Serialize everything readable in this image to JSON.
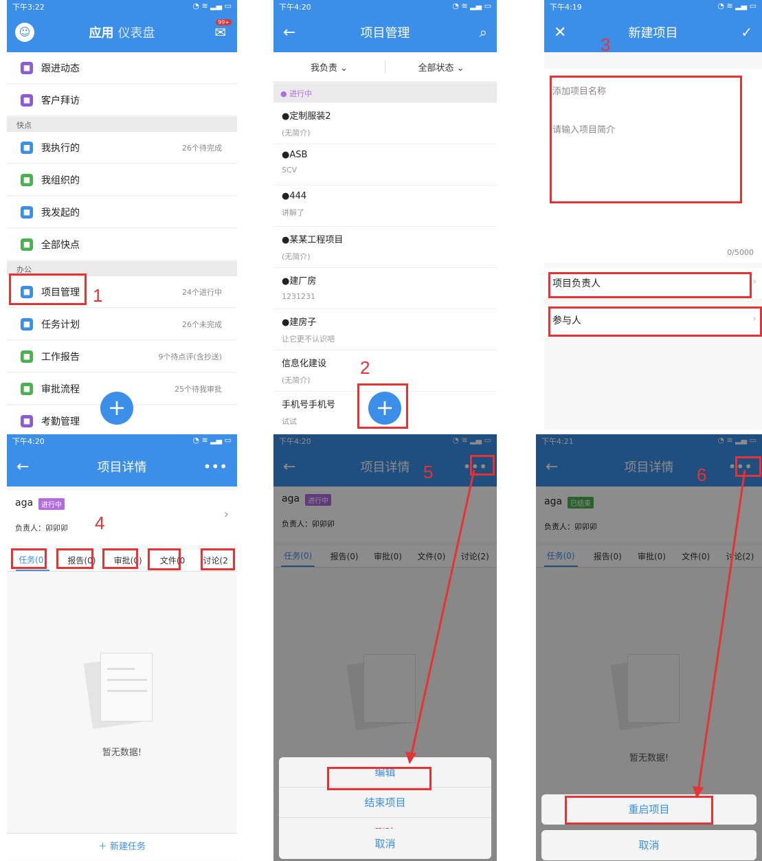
{
  "p1": {
    "time": "下午3:22",
    "tab_app": "应用",
    "tab_dashboard": "仪表盘",
    "badge": "99+",
    "rows_top": [
      {
        "label": "跟进动态",
        "icon": "user-icon",
        "color": "#8e5bd6"
      },
      {
        "label": "客户拜访",
        "icon": "location-icon",
        "color": "#8e5bd6"
      }
    ],
    "section_kd": "快点",
    "rows_kd": [
      {
        "label": "我执行的",
        "right": "26个待完成",
        "icon": "pin-icon",
        "color": "#3b8fe8"
      },
      {
        "label": "我组织的",
        "right": "",
        "icon": "org-icon",
        "color": "#4caf50"
      },
      {
        "label": "我发起的",
        "right": "",
        "icon": "send-icon",
        "color": "#3b8fe8"
      },
      {
        "label": "全部快点",
        "right": "",
        "icon": "layers-icon",
        "color": "#4caf50"
      }
    ],
    "section_office": "办公",
    "rows_office": [
      {
        "label": "项目管理",
        "right": "24个进行中",
        "icon": "folder-icon",
        "color": "#3b8fe8"
      },
      {
        "label": "任务计划",
        "right": "26个未完成",
        "icon": "flag-icon",
        "color": "#3b8fe8"
      },
      {
        "label": "工作报告",
        "right": "9个待点评(含抄送)",
        "icon": "report-icon",
        "color": "#4caf50"
      },
      {
        "label": "审批流程",
        "right": "25个待我审批",
        "icon": "stamp-icon",
        "color": "#4caf50"
      },
      {
        "label": "考勤管理",
        "right": "",
        "icon": "clock-icon",
        "color": "#8e5bd6"
      }
    ],
    "mark": "1"
  },
  "p2": {
    "time": "下午4:20",
    "title": "项目管理",
    "filter1": "我负责 ⌄",
    "filter2": "全部状态 ⌄",
    "status_head": "● 进行中",
    "items": [
      {
        "title": "●定制服装2",
        "sub": "(无简介)"
      },
      {
        "title": "●ASB",
        "sub": "SCV"
      },
      {
        "title": "●444",
        "sub": "讲解了"
      },
      {
        "title": "●某某工程项目",
        "sub": "(无简介)"
      },
      {
        "title": "●建厂房",
        "sub": "1231231"
      },
      {
        "title": "●建房子",
        "sub": "让它更不认识吧"
      },
      {
        "title": "信息化建设",
        "sub": "(无简介)"
      },
      {
        "title": "手机号手机号",
        "sub": "试试"
      }
    ],
    "mark": "2"
  },
  "p3": {
    "time": "下午4:19",
    "title": "新建项目",
    "name_placeholder": "添加项目名称",
    "desc_placeholder": "请输入项目简介",
    "counter": "0/5000",
    "owner_label": "项目负责人",
    "members_label": "参与人",
    "mark": "3"
  },
  "p4": {
    "time": "下午4:20",
    "title": "项目详情",
    "project_name": "aga",
    "status": "进行中",
    "owner": "负责人：卯卯卯",
    "tabs": [
      "任务(0)",
      "报告(0)",
      "审批(0)",
      "文件(0",
      "讨论(2"
    ],
    "empty": "暂无数据!",
    "new_task": "＋ 新建任务",
    "mark": "4"
  },
  "p5": {
    "time": "下午4:20",
    "title": "项目详情",
    "project_name": "aga",
    "status": "进行中",
    "owner": "负责人：卯卯卯",
    "tabs": [
      "任务(0)",
      "报告(0)",
      "审批(0)",
      "文件(0)",
      "讨论(2)"
    ],
    "actions": [
      "编辑",
      "结束项目",
      "删除"
    ],
    "cancel": "取消",
    "mark": "5"
  },
  "p6": {
    "time": "下午4:21",
    "title": "项目详情",
    "project_name": "aga",
    "status": "已结束",
    "owner": "负责人：卯卯卯",
    "tabs": [
      "任务(0)",
      "报告(0)",
      "审批(0)",
      "文件(0)",
      "讨论(2)"
    ],
    "empty": "暂无数据!",
    "action": "重启项目",
    "cancel": "取消",
    "mark": "6"
  },
  "colors": {
    "brand": "#3b8fe8",
    "highlight": "#e53333",
    "status_active": "#b36be0",
    "status_done": "#4caf50"
  }
}
